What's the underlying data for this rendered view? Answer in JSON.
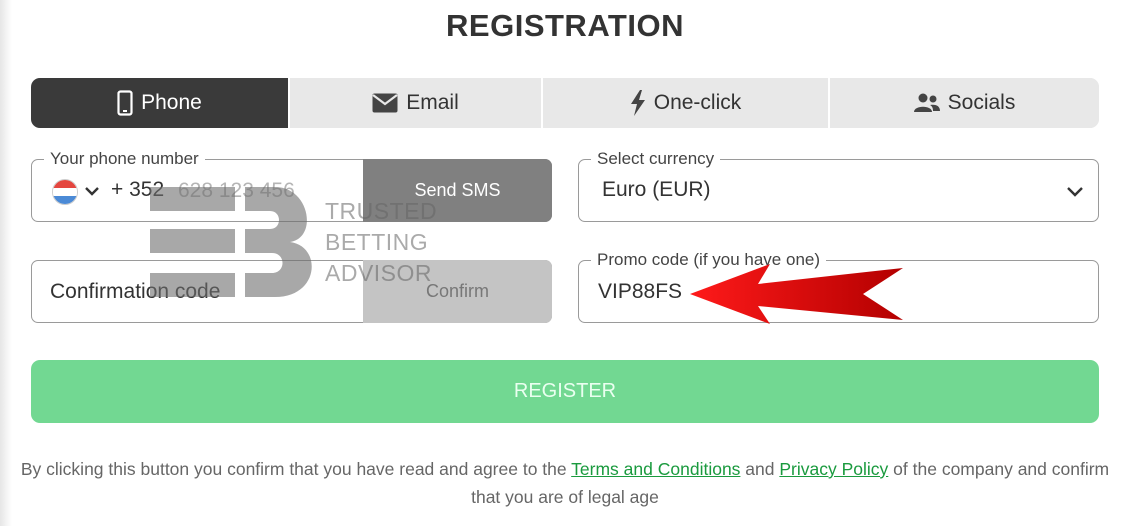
{
  "page_title": "REGISTRATION",
  "tabs": [
    {
      "label": "Phone",
      "icon": "mobile-phone-icon",
      "active": true
    },
    {
      "label": "Email",
      "icon": "envelope-icon",
      "active": false
    },
    {
      "label": "One-click",
      "icon": "lightning-bolt-icon",
      "active": false
    },
    {
      "label": "Socials",
      "icon": "users-icon",
      "active": false
    }
  ],
  "phone": {
    "legend": "Your phone number",
    "dial_code": "+ 352",
    "placeholder": "628 123 456",
    "send_button": "Send SMS",
    "flag": "luxembourg-flag-icon"
  },
  "currency": {
    "legend": "Select currency",
    "value": "Euro (EUR)"
  },
  "confirmation": {
    "placeholder": "Confirmation code",
    "button": "Confirm"
  },
  "promo": {
    "legend": "Promo code (if you have one)",
    "value": "VIP88FS"
  },
  "register_button": "REGISTER",
  "disclaimer": {
    "prefix": "By clicking this button you confirm that you have read and agree to the",
    "terms_link": "Terms and Conditions",
    "and": "and",
    "privacy_link": "Privacy Policy",
    "suffix": "of the company and confirm that you are of legal age"
  },
  "watermark": {
    "line1": "TRUSTED",
    "line2": "BETTING",
    "line3": "ADVISOR"
  },
  "colors": {
    "active_tab": "#3a3a3a",
    "register_green": "#72d892",
    "link_green": "#1a9a3e",
    "arrow_red": "#d40000"
  }
}
